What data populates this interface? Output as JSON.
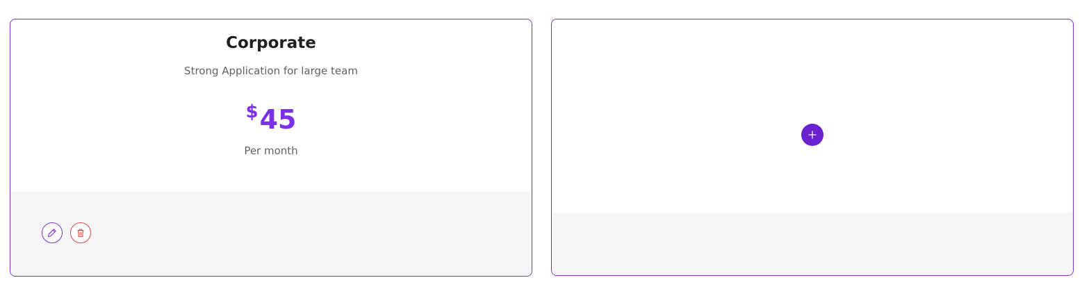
{
  "plan_card": {
    "title": "Corporate",
    "subtitle": "Strong Application for large team",
    "currency": "$",
    "price": "45",
    "period": "Per month",
    "edit_icon": "pencil-icon",
    "delete_icon": "trash-icon"
  },
  "add_card": {
    "add_icon": "plus-icon"
  },
  "colors": {
    "accent": "#7b2fe8",
    "border": "#7b2fd6",
    "danger": "#e0433e",
    "footer_bg": "#f5f5f6",
    "text_muted": "#5f6368"
  }
}
